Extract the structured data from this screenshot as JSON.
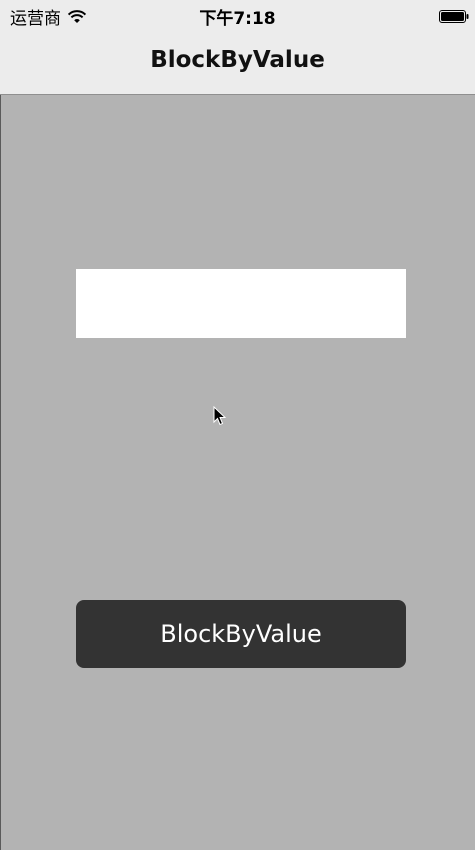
{
  "status_bar": {
    "carrier": "运营商",
    "time": "下午7:18",
    "wifi_icon": "wifi-icon",
    "battery_icon": "battery-icon"
  },
  "nav_bar": {
    "title": "BlockByValue"
  },
  "main": {
    "text_field": {
      "value": "",
      "placeholder": ""
    },
    "button_label": "BlockByValue"
  },
  "colors": {
    "background": "#b3b3b3",
    "nav_background": "#ececec",
    "button_background": "#333333",
    "button_text": "#ffffff",
    "field_background": "#ffffff"
  }
}
